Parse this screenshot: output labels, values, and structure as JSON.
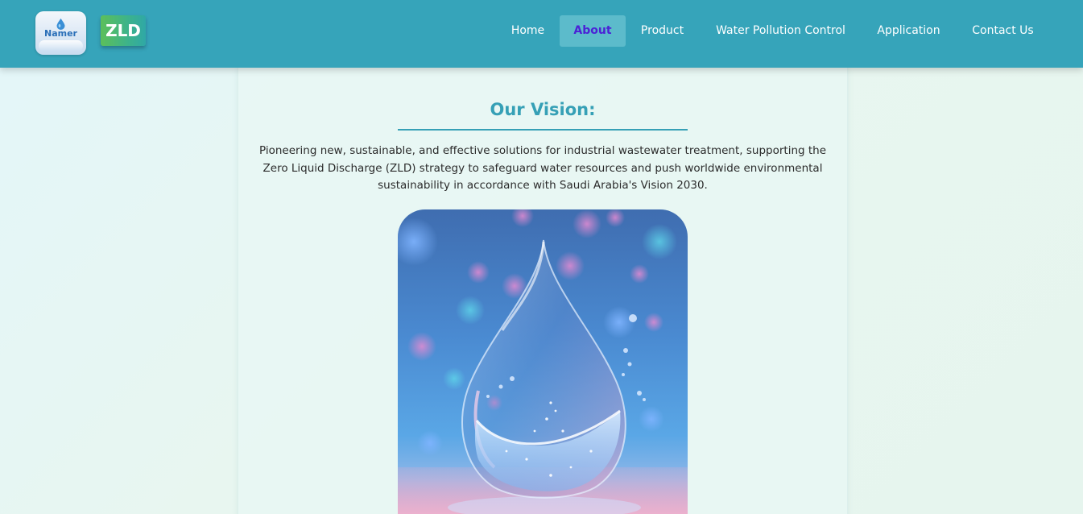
{
  "header": {
    "logo_namer": {
      "text": "Namer",
      "icon": "water-drop-icon"
    },
    "logo_zld": {
      "text": "ZLD"
    },
    "nav": [
      {
        "label": "Home",
        "active": false
      },
      {
        "label": "About",
        "active": true
      },
      {
        "label": "Product",
        "active": false
      },
      {
        "label": "Water Pollution Control",
        "active": false
      },
      {
        "label": "Application",
        "active": false
      },
      {
        "label": "Contact Us",
        "active": false
      }
    ]
  },
  "main": {
    "vision": {
      "title": "Our Vision:",
      "text": "Pioneering new, sustainable, and effective solutions for industrial wastewater treatment, supporting the Zero Liquid Discharge (ZLD) strategy to safeguard water resources and push worldwide environmental sustainability in accordance with Saudi Arabia's Vision 2030."
    },
    "image": {
      "subject": "water-drop-splash-image"
    }
  },
  "colors": {
    "header_bg": "#36a4ba",
    "accent": "#36a0b6",
    "active_nav_text": "#4b22d6",
    "active_nav_bg": "#5cbbcb"
  }
}
